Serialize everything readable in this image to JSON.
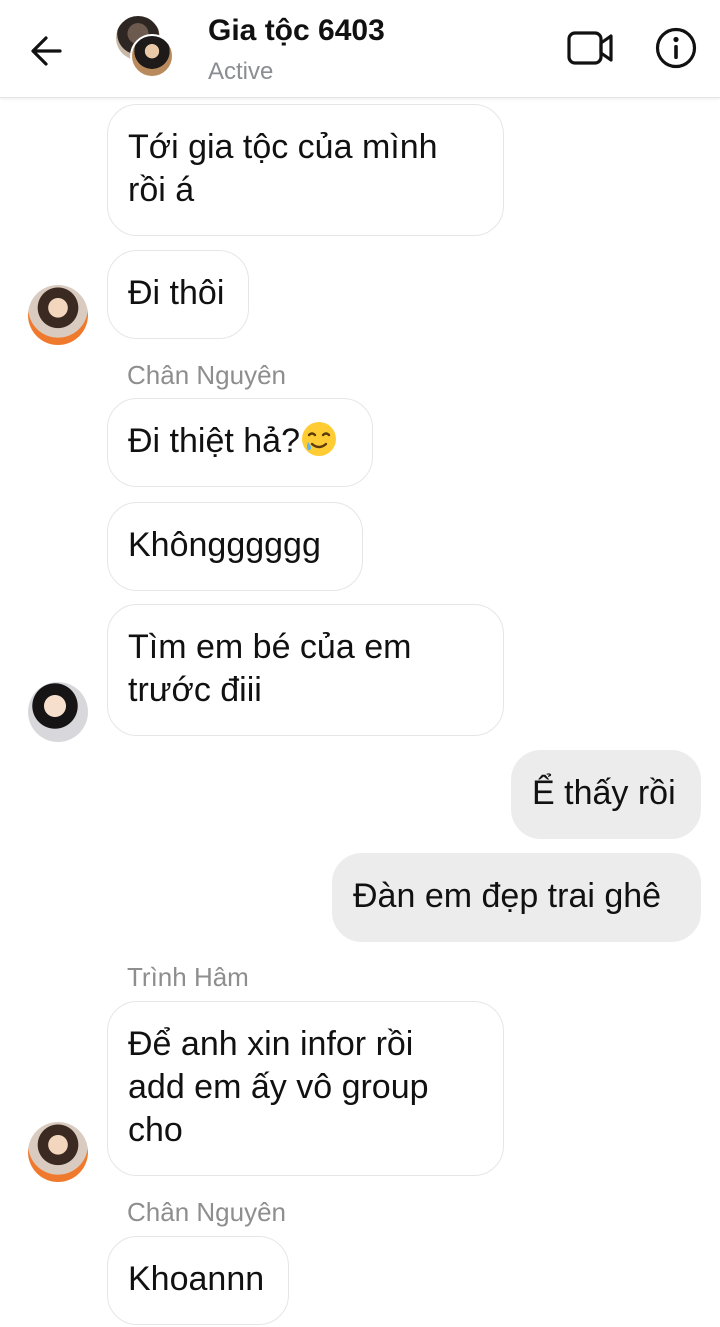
{
  "header": {
    "title": "Gia tộc 6403",
    "status": "Active",
    "icons": {
      "back": "back-arrow-icon",
      "video": "video-call-icon",
      "info": "info-icon"
    }
  },
  "messages": [
    {
      "text": "Tới gia tộc của mình\nrồi á"
    },
    {
      "text": "Đi thôi"
    },
    {
      "sender": "Chân Nguyên",
      "text": "Đi thiệt hả?",
      "emoji": "smiling-face-with-tear-emoji"
    },
    {
      "text": "Khôngggggg"
    },
    {
      "text": "Tìm em bé của em\ntrước điii"
    },
    {
      "text": "Ể thấy rồi"
    },
    {
      "text": "Đàn em đẹp trai ghê"
    },
    {
      "sender": "Trình Hâm",
      "text": "Để anh xin infor rồi\nadd em ấy vô group\ncho"
    },
    {
      "sender": "Chân Nguyên",
      "text": "Khoannn"
    }
  ],
  "colors": {
    "outgoing_bubble": "#ececec",
    "incoming_border": "#e6e6e6",
    "secondary_text": "#8e8e8e"
  }
}
